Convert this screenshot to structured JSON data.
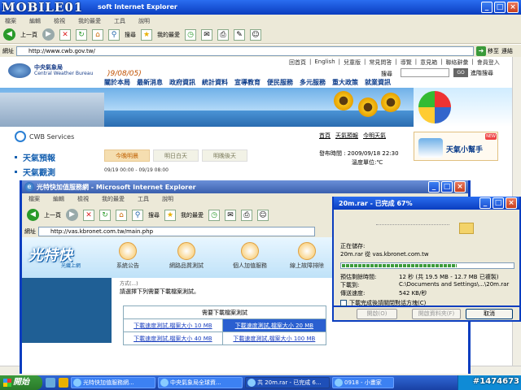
{
  "site_logo": "MOBILE01",
  "watermark": "#1474673",
  "ie1": {
    "title": "soft Internet Explorer",
    "menu": [
      "檔案",
      "編輯",
      "檢視",
      "我的最愛",
      "工具",
      "說明"
    ],
    "toolbar": {
      "back": "上一頁",
      "search": "搜尋",
      "favorites": "我的最愛"
    },
    "address_label": "網址",
    "address": "http://www.cwb.gov.tw/",
    "go": "移至",
    "links": "連結"
  },
  "cwb": {
    "name_zh": "中央氣象局",
    "name_en": "Central Weather Bureau",
    "date": ")9/08/05)",
    "top_links": [
      "回首頁",
      "English",
      "兒童版",
      "常見問答",
      "導覽",
      "意見箱",
      "聯絡辭彙",
      "會員登入"
    ],
    "search_label": "搜尋",
    "search_go": "GO",
    "search_adv": "進階搜尋",
    "nav": [
      "關於本局",
      "最新消息",
      "政府資訊",
      "統計資料",
      "宣導教育",
      "便民服務",
      "多元服務",
      "重大政策",
      "就業資訊"
    ],
    "services_title": "CWB Services",
    "side": [
      "天氣預報",
      "天氣觀測"
    ],
    "tabs": [
      "今晚明晨",
      "明日白天",
      "明晚後天"
    ],
    "tab_date": "09/19 00:00 - 09/19 08:00",
    "crumbs": [
      "首頁",
      "天氣預報",
      "今明天氣"
    ],
    "published": "發布時間 : 2009/09/18 22:30",
    "temp_unit": "溫度單位:℃",
    "helper": "天氣小幫手",
    "helper_badge": "NEW"
  },
  "ie2": {
    "title": "光特快加值服務網 - Microsoft Internet Explorer",
    "menu": [
      "檔案",
      "編輯",
      "檢視",
      "我的最愛",
      "工具",
      "說明"
    ],
    "toolbar": {
      "back": "上一頁",
      "search": "搜尋",
      "favorites": "我的最愛"
    },
    "address_label": "網址",
    "address": "http://vas.kbronet.com.tw/main.php",
    "logo": "光特快",
    "logo_sub": "光纖上網",
    "nav": [
      "系統公告",
      "網路品質測試",
      "個人加值服務",
      "線上故障排除"
    ],
    "msg1": "方式(...)",
    "msg2": "請選擇下列需要下載檔案測試。",
    "table": {
      "header": "需要下載檔案測試",
      "rows": [
        [
          "下載速度測試,檔案大小 10 MB",
          "下載速度測試,檔案大小 20 MB"
        ],
        [
          "下載速度測試,檔案大小 40 MB",
          "下載速度測試,檔案大小 100 MB"
        ]
      ]
    }
  },
  "dlg": {
    "title": "20m.rar - 已完成 67%",
    "saving_label": "正在儲存:",
    "saving_value": "20m.rar 從 vas.kbronet.com.tw",
    "progress": 0.67,
    "eta_label": "預估剩餘時間:",
    "eta_value": "12 秒 (共 19.5 MB - 12.7 MB 已複製)",
    "dest_label": "下載到:",
    "dest_value": "C:\\Documents and Settings\\...\\20m.rar",
    "rate_label": "傳送速度:",
    "rate_value": "542 KB/秒",
    "close_on_complete": "下載完成後請關閉對話方塊(C)",
    "btn_open": "開啟(O)",
    "btn_open_folder": "開啟資料夾(F)",
    "btn_cancel": "取消"
  },
  "taskbar": {
    "start": "開始",
    "buttons": [
      "光特快加值服務網...",
      "中央氣象局全球資...",
      "共 20m.rar - 已完成 6...",
      "0918 - 小畫家"
    ],
    "active_index": 2
  }
}
